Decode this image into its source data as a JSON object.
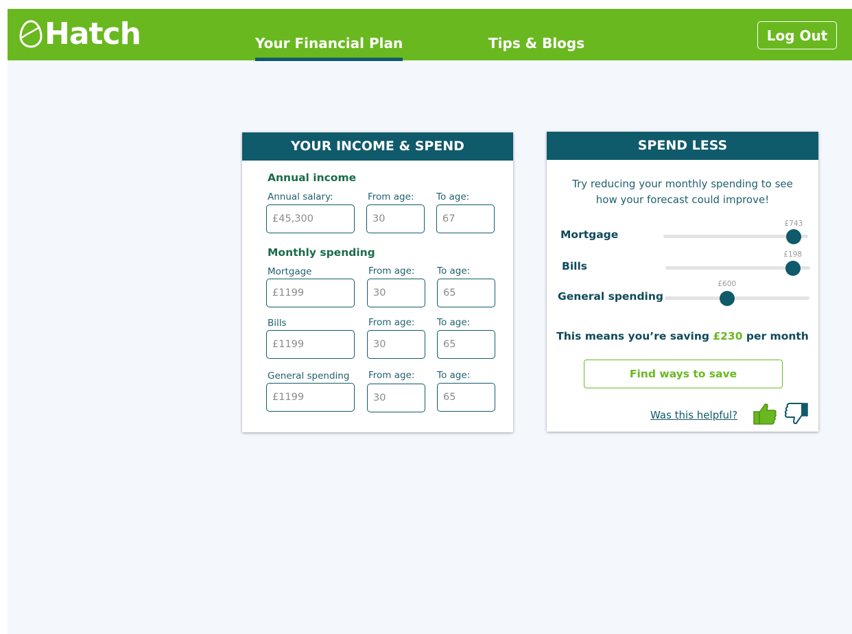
{
  "header": {
    "logo_text": "Hatch",
    "tabs": [
      {
        "label": "Your Financial Plan",
        "active": true
      },
      {
        "label": "Tips & Blogs",
        "active": false
      }
    ],
    "logout_label": "Log Out"
  },
  "income_card": {
    "title": "YOUR INCOME & SPEND",
    "annual_income_title": "Annual income",
    "annual_salary": {
      "label": "Annual salary:",
      "value": "£45,300"
    },
    "from_age_label": "From age:",
    "to_age_label": "To age:",
    "income_from_age": "30",
    "income_to_age": "67",
    "monthly_spending_title": "Monthly spending",
    "rows": [
      {
        "label": "Mortgage",
        "value": "£1199",
        "from_age": "30",
        "to_age": "65"
      },
      {
        "label": "Bills",
        "value": "£1199",
        "from_age": "30",
        "to_age": "65"
      },
      {
        "label": "General spending",
        "value": "£1199",
        "from_age": "30",
        "to_age": "65"
      }
    ]
  },
  "spend_card": {
    "title": "SPEND LESS",
    "intro_line1": "Try reducing your monthly spending to see",
    "intro_line2": "how your forecast could improve!",
    "sliders": [
      {
        "label": "Mortgage",
        "value_text": "£743",
        "fraction": 0.9
      },
      {
        "label": "Bills",
        "value_text": "£198",
        "fraction": 0.88
      },
      {
        "label": "General spending",
        "value_text": "£600",
        "fraction": 0.43
      }
    ],
    "saving_prefix": "This means you’re saving ",
    "saving_amount": "£230",
    "saving_suffix": " per month",
    "save_button_label": "Find ways to save",
    "helpful_text": "Was this helpful?"
  },
  "colors": {
    "brand_green": "#6ab820",
    "brand_teal": "#0f5a6b",
    "page_background": "#f4f7fb"
  }
}
